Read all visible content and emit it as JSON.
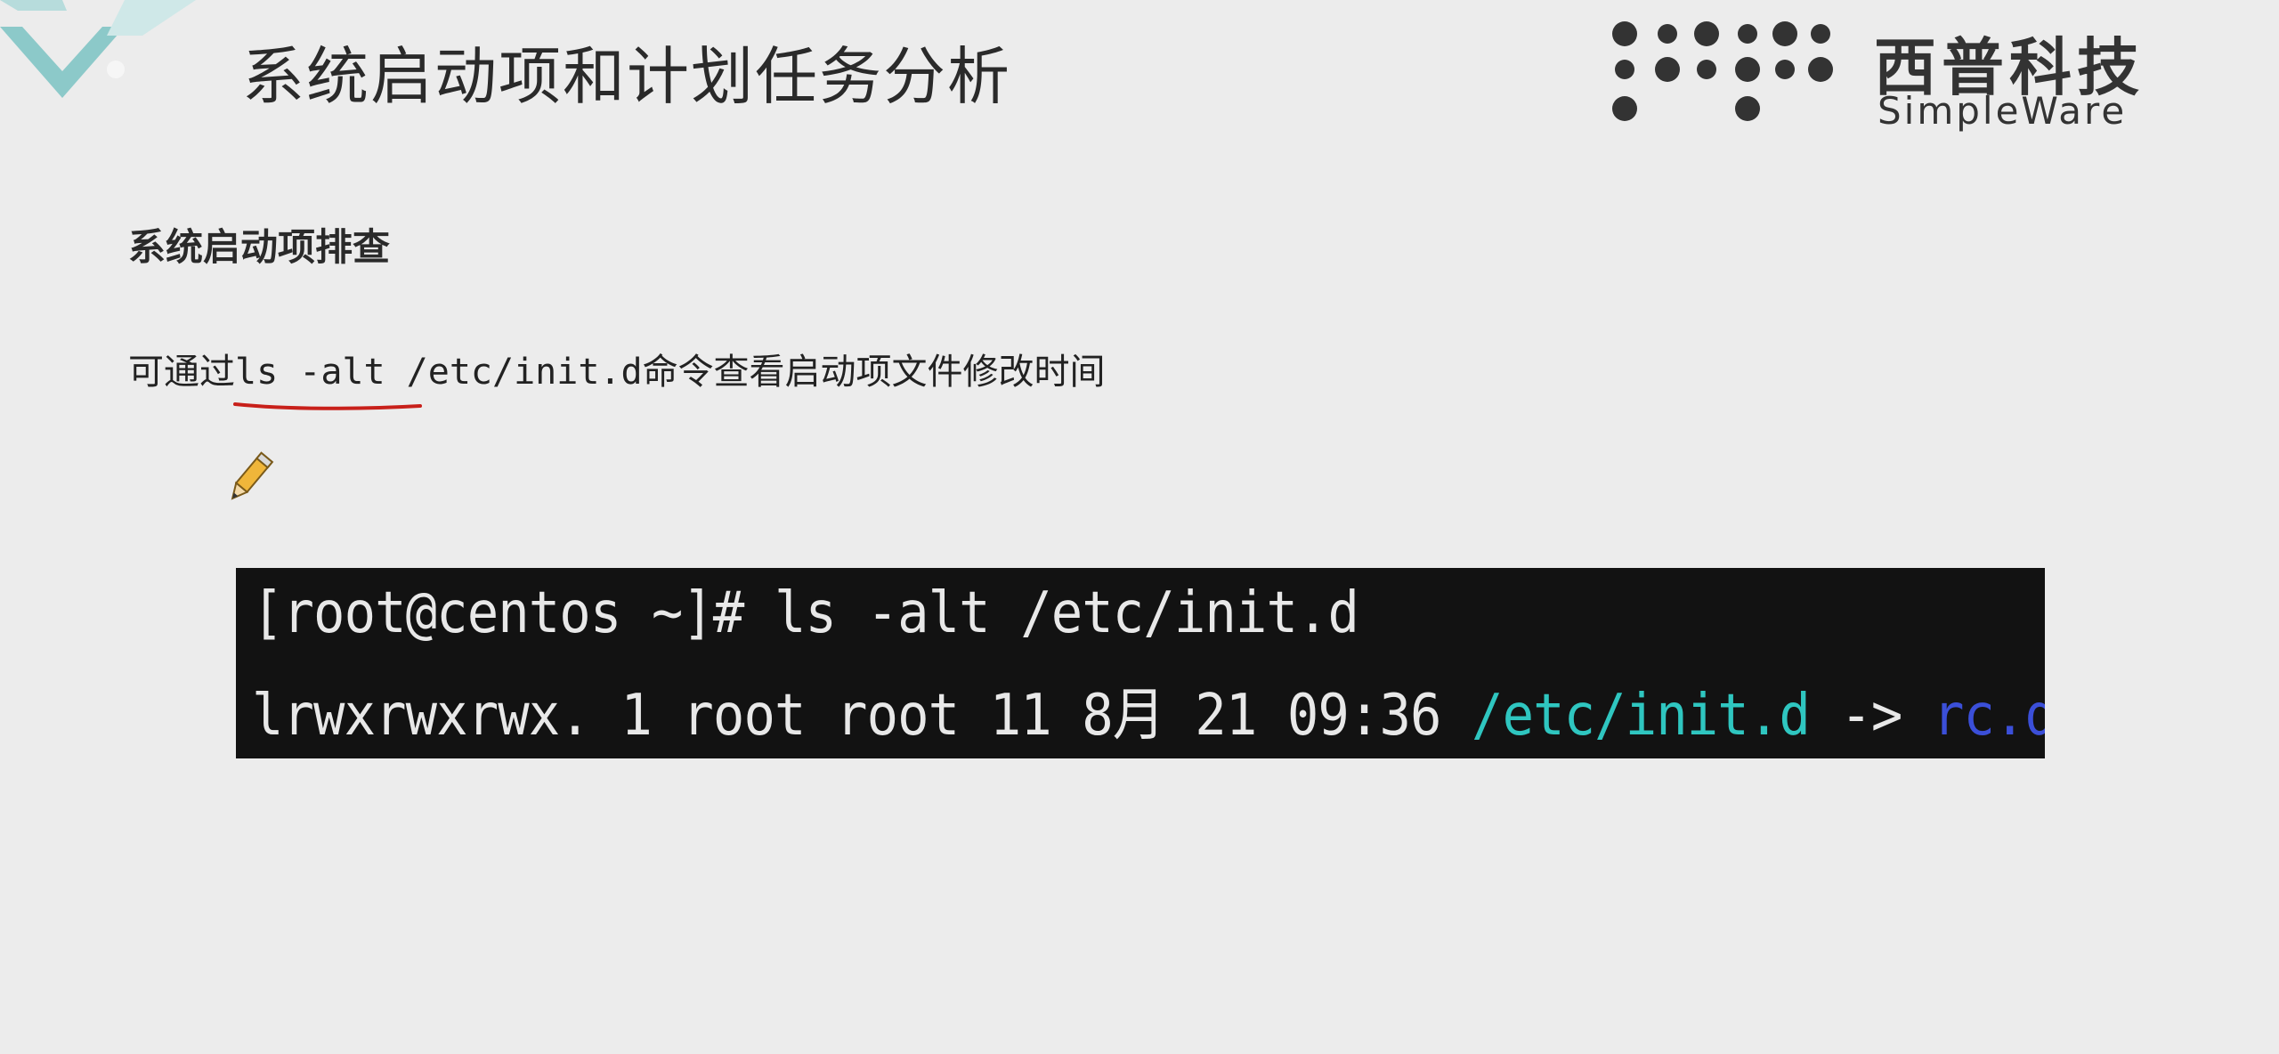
{
  "slide": {
    "title": "系统启动项和计划任务分析"
  },
  "logo": {
    "chinese_name": "西普科技",
    "english_name": "SimpleWare"
  },
  "content": {
    "heading": "系统启动项排查",
    "desc_prefix": "可通过",
    "desc_command": "ls -alt /etc/init.d",
    "desc_suffix": "命令查看启动项文件修改时间"
  },
  "terminal": {
    "line1": "[root@centos ~]# ls -alt /etc/init.d",
    "line2_plain": "lrwxrwxrwx. 1 root root 11 8月  21 09:36 ",
    "line2_link": "/etc/init.d",
    "line2_arrow": " -> ",
    "line2_target": "rc.d/init.d"
  },
  "colors": {
    "background": "#ececec",
    "terminal_bg": "#121212",
    "terminal_text": "#e8e8e8",
    "link_cyan": "#2fc6c0",
    "target_blue": "#3b4fd8",
    "annotation_red": "#c8201a"
  },
  "icons": {
    "corner": "chevron-decoration",
    "pencil": "pencil-icon"
  }
}
